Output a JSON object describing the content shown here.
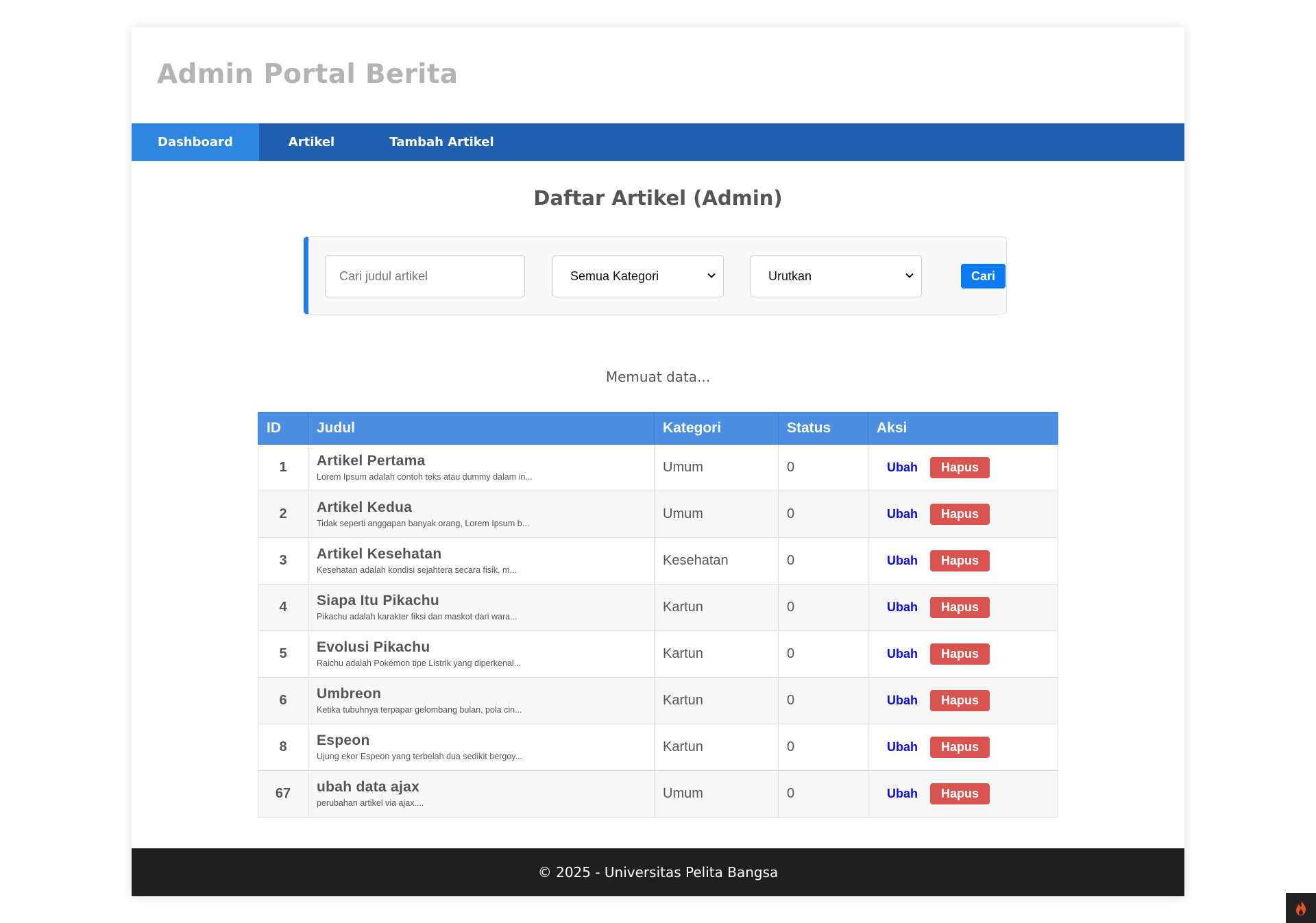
{
  "header": {
    "title": "Admin Portal Berita"
  },
  "nav": {
    "items": [
      {
        "label": "Dashboard"
      },
      {
        "label": "Artikel"
      },
      {
        "label": "Tambah Artikel"
      }
    ]
  },
  "main": {
    "title": "Daftar Artikel (Admin)",
    "loading_text": "Memuat data...",
    "filter": {
      "search_placeholder": "Cari judul artikel",
      "category_value": "Semua Kategori",
      "sort_value": "Urutkan",
      "search_button": "Cari"
    },
    "table": {
      "headers": [
        "ID",
        "Judul",
        "Kategori",
        "Status",
        "Aksi"
      ],
      "edit_label": "Ubah",
      "delete_label": "Hapus",
      "rows": [
        {
          "id": "1",
          "title": "Artikel Pertama",
          "excerpt": "Lorem Ipsum adalah contoh teks atau dummy dalam in...",
          "category": "Umum",
          "status": "0"
        },
        {
          "id": "2",
          "title": "Artikel Kedua",
          "excerpt": "Tidak seperti anggapan banyak orang, Lorem Ipsum b...",
          "category": "Umum",
          "status": "0"
        },
        {
          "id": "3",
          "title": "Artikel Kesehatan",
          "excerpt": "Kesehatan adalah kondisi sejahtera secara fisik, m...",
          "category": "Kesehatan",
          "status": "0"
        },
        {
          "id": "4",
          "title": "Siapa Itu Pikachu",
          "excerpt": "Pikachu adalah karakter fiksi dan maskot dari wara...",
          "category": "Kartun",
          "status": "0"
        },
        {
          "id": "5",
          "title": "Evolusi Pikachu",
          "excerpt": "Raichu adalah Pokémon tipe Listrik yang diperkenal...",
          "category": "Kartun",
          "status": "0"
        },
        {
          "id": "6",
          "title": "Umbreon",
          "excerpt": "Ketika tubuhnya terpapar gelombang bulan, pola cin...",
          "category": "Kartun",
          "status": "0"
        },
        {
          "id": "8",
          "title": "Espeon",
          "excerpt": "Ujung ekor Espeon yang terbelah dua sedikit bergoy...",
          "category": "Kartun",
          "status": "0"
        },
        {
          "id": "67",
          "title": "ubah data ajax",
          "excerpt": "perubahan artikel via ajax....",
          "category": "Umum",
          "status": "0"
        }
      ]
    }
  },
  "footer": {
    "text": "© 2025 - Universitas Pelita Bangsa"
  },
  "colors": {
    "nav": "#2160ae",
    "nav_active": "#2f86e0",
    "table_header": "#4a8fe2",
    "danger": "#d9534f",
    "primary": "#0a7bf5"
  },
  "icons": {
    "corner_badge": "flame-icon",
    "select_arrow": "chevron-down-icon"
  }
}
